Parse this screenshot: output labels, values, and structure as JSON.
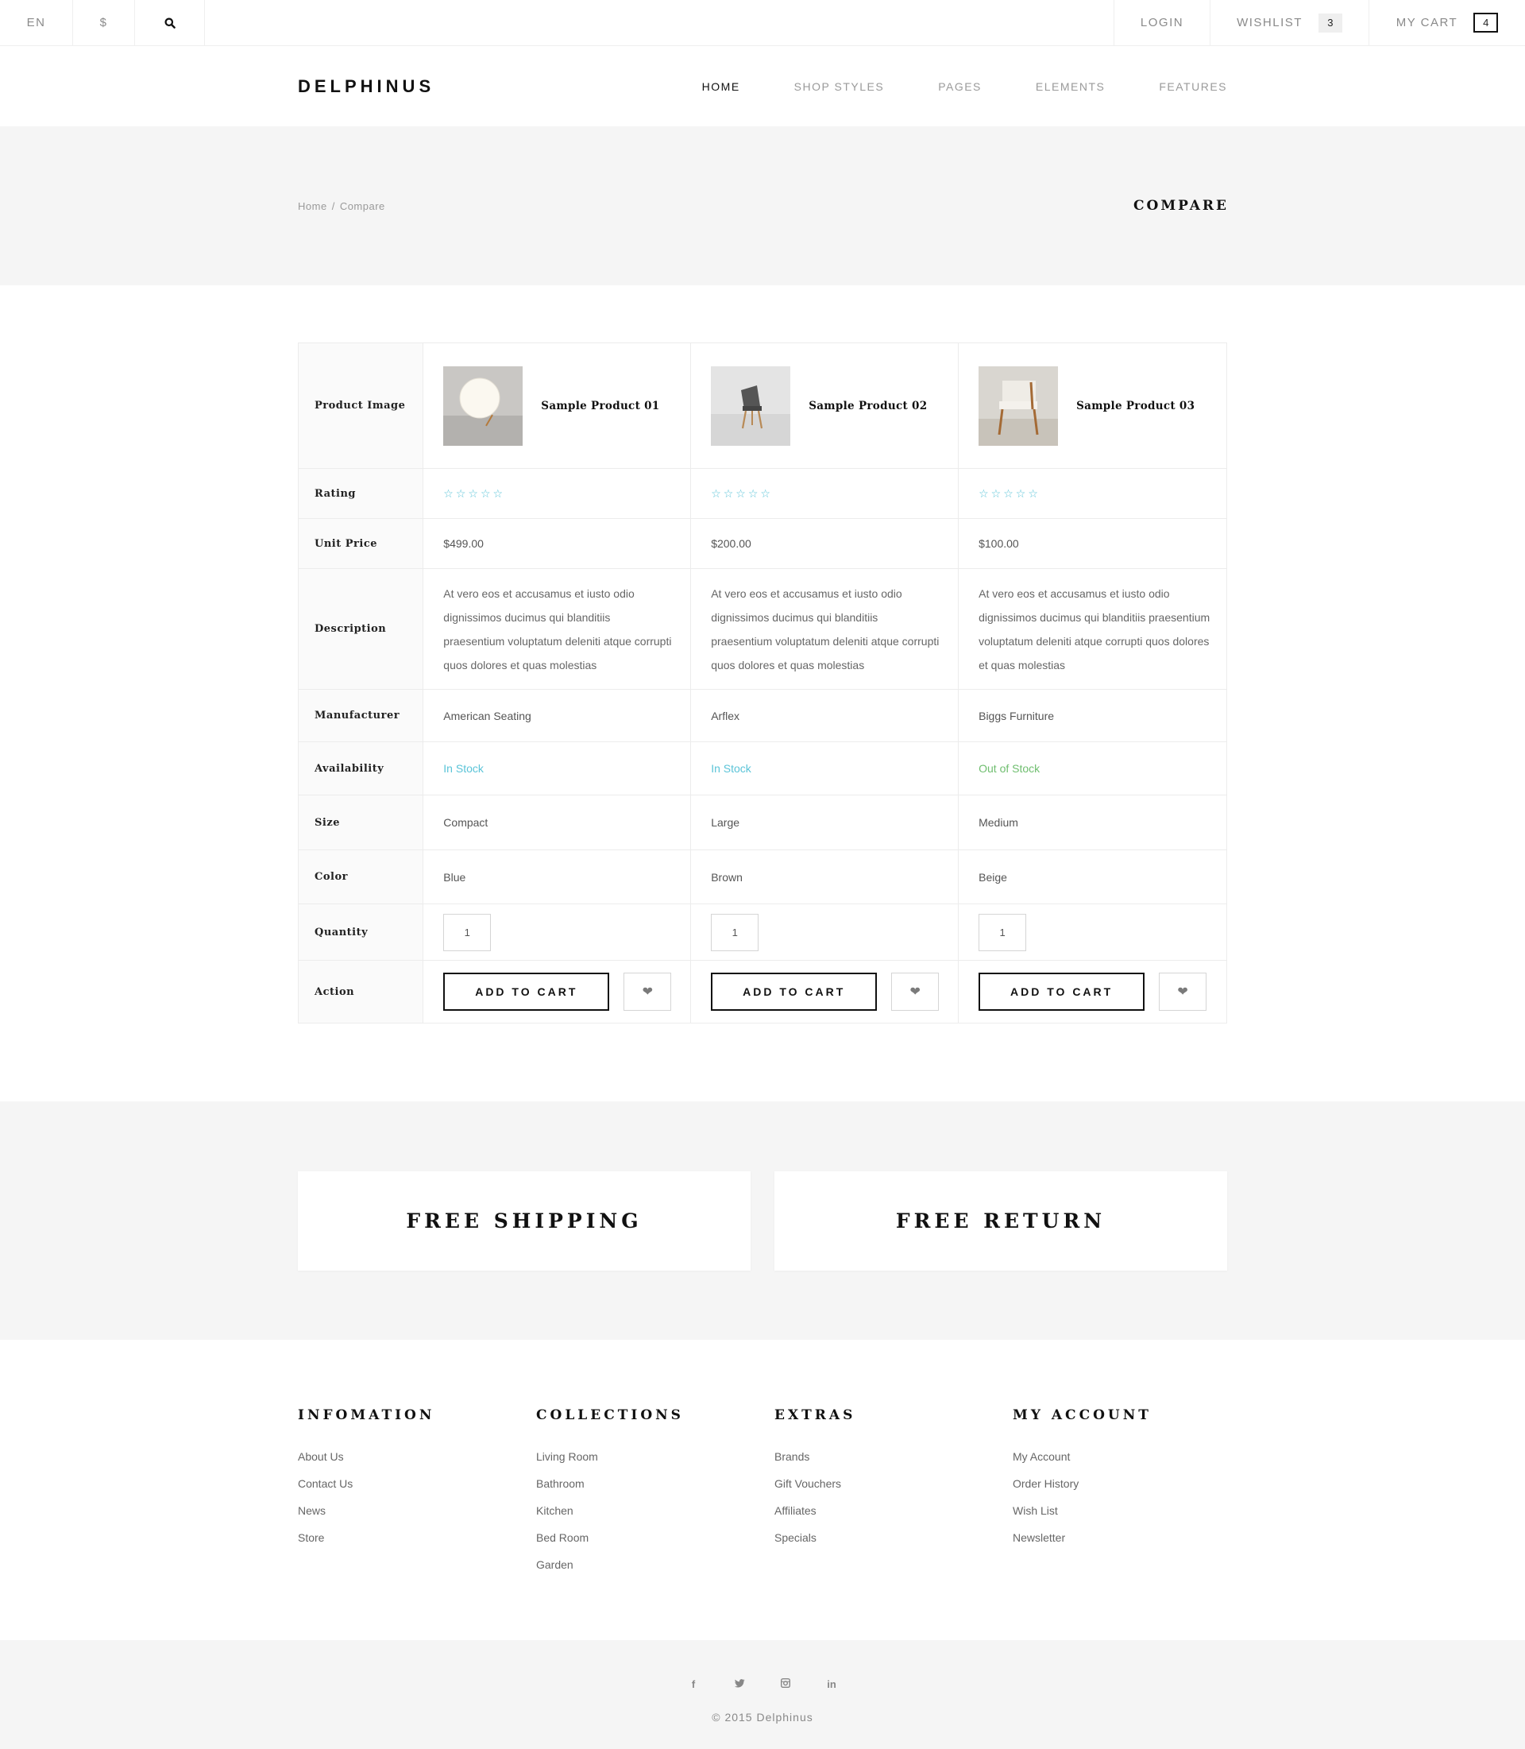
{
  "topbar": {
    "lang": "EN",
    "currency": "$",
    "login": "LOGIN",
    "wishlist_label": "WISHLIST",
    "wishlist_count": "3",
    "cart_label": "MY CART",
    "cart_count": "4"
  },
  "header": {
    "logo": "DELPHINUS",
    "nav": [
      "HOME",
      "SHOP STYLES",
      "PAGES",
      "ELEMENTS",
      "FEATURES"
    ]
  },
  "band": {
    "breadcrumb": [
      "Home",
      "Compare"
    ],
    "separator": "/",
    "title": "COMPARE"
  },
  "compare": {
    "labels": {
      "image": "Product Image",
      "rating": "Rating",
      "price": "Unit Price",
      "description": "Description",
      "manufacturer": "Manufacturer",
      "availability": "Availability",
      "size": "Size",
      "color": "Color",
      "quantity": "Quantity",
      "action": "Action"
    },
    "products": [
      {
        "name": "Sample Product 01",
        "rating": "☆☆☆☆☆",
        "price": "$499.00",
        "description": "At vero eos et accusamus et iusto odio dignissimos ducimus qui blanditiis praesentium voluptatum deleniti atque corrupti quos dolores et quas molestias",
        "manufacturer": "American Seating",
        "availability": "In Stock",
        "size": "Compact",
        "color": "Blue",
        "quantity": "1",
        "cart_label": "ADD TO CART"
      },
      {
        "name": "Sample Product 02",
        "rating": "☆☆☆☆☆",
        "price": "$200.00",
        "description": "At vero eos et accusamus et iusto odio dignissimos ducimus qui blanditiis praesentium voluptatum deleniti atque corrupti quos dolores et quas molestias",
        "manufacturer": "Arflex",
        "availability": "In Stock",
        "size": "Large",
        "color": "Brown",
        "quantity": "1",
        "cart_label": "ADD TO CART"
      },
      {
        "name": "Sample Product 03",
        "rating": "☆☆☆☆☆",
        "price": "$100.00",
        "description": "At vero eos et accusamus et iusto odio dignissimos ducimus qui blanditiis praesentium voluptatum deleniti atque corrupti quos dolores et quas molestias",
        "manufacturer": "Biggs Furniture",
        "availability": "Out of Stock",
        "size": "Medium",
        "color": "Beige",
        "quantity": "1",
        "cart_label": "ADD TO CART"
      }
    ]
  },
  "features": [
    "FREE SHIPPING",
    "FREE RETURN"
  ],
  "footer": {
    "columns": [
      {
        "title": "INFOMATION",
        "links": [
          "About Us",
          "Contact Us",
          "News",
          "Store"
        ]
      },
      {
        "title": "COLLECTIONS",
        "links": [
          "Living Room",
          "Bathroom",
          "Kitchen",
          "Bed Room",
          "Garden"
        ]
      },
      {
        "title": "EXTRAS",
        "links": [
          "Brands",
          "Gift Vouchers",
          "Affiliates",
          "Specials"
        ]
      },
      {
        "title": "MY ACCOUNT",
        "links": [
          "My Account",
          "Order History",
          "Wish List",
          "Newsletter"
        ]
      }
    ],
    "social_icons": [
      "facebook-icon",
      "twitter-icon",
      "instagram-icon",
      "linkedin-icon"
    ],
    "copyright": "© 2015 Delphinus"
  },
  "colors": {
    "accent": "#5bc4d8",
    "out_of_stock": "#6fbe6f",
    "band_bg": "#f5f5f5"
  }
}
